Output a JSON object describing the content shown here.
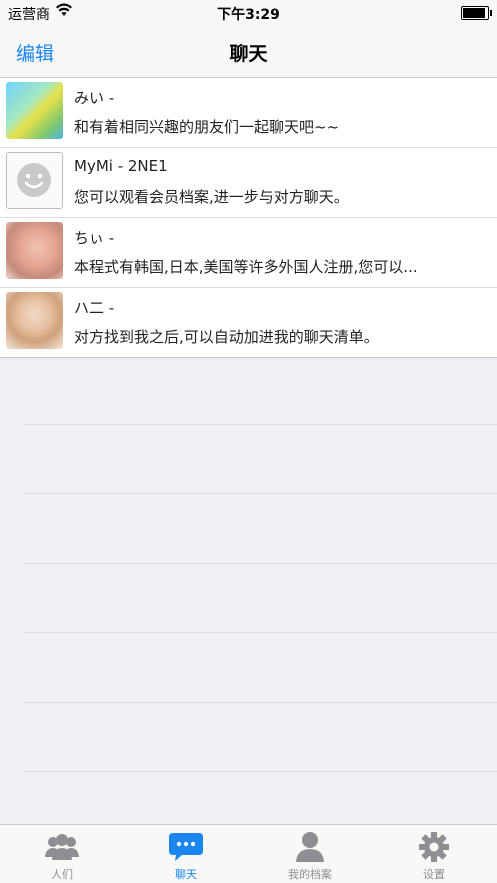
{
  "status": {
    "carrier": "运营商",
    "time": "下午3:29",
    "battery_level": 0.9
  },
  "nav": {
    "edit_label": "编辑",
    "title": "聊天"
  },
  "chats": [
    {
      "name": "みい -",
      "message": "和有着相同兴趣的朋友们一起聊天吧~~"
    },
    {
      "name": "MyMi - 2NE1",
      "message": "您可以观看会员档案,进一步与对方聊天。"
    },
    {
      "name": "ちぃ -",
      "message": "本程式有韩国,日本,美国等许多外国人注册,您可以..."
    },
    {
      "name": "ハ二 -",
      "message": "对方找到我之后,可以自动加进我的聊天清单。"
    }
  ],
  "tabs": [
    {
      "label": "人们",
      "icon": "people-icon"
    },
    {
      "label": "聊天",
      "icon": "chat-icon"
    },
    {
      "label": "我的档案",
      "icon": "profile-icon"
    },
    {
      "label": "设置",
      "icon": "gear-icon"
    }
  ],
  "active_tab": 1,
  "colors": {
    "accent": "#1a86f0",
    "inactive": "#8e8e93"
  }
}
